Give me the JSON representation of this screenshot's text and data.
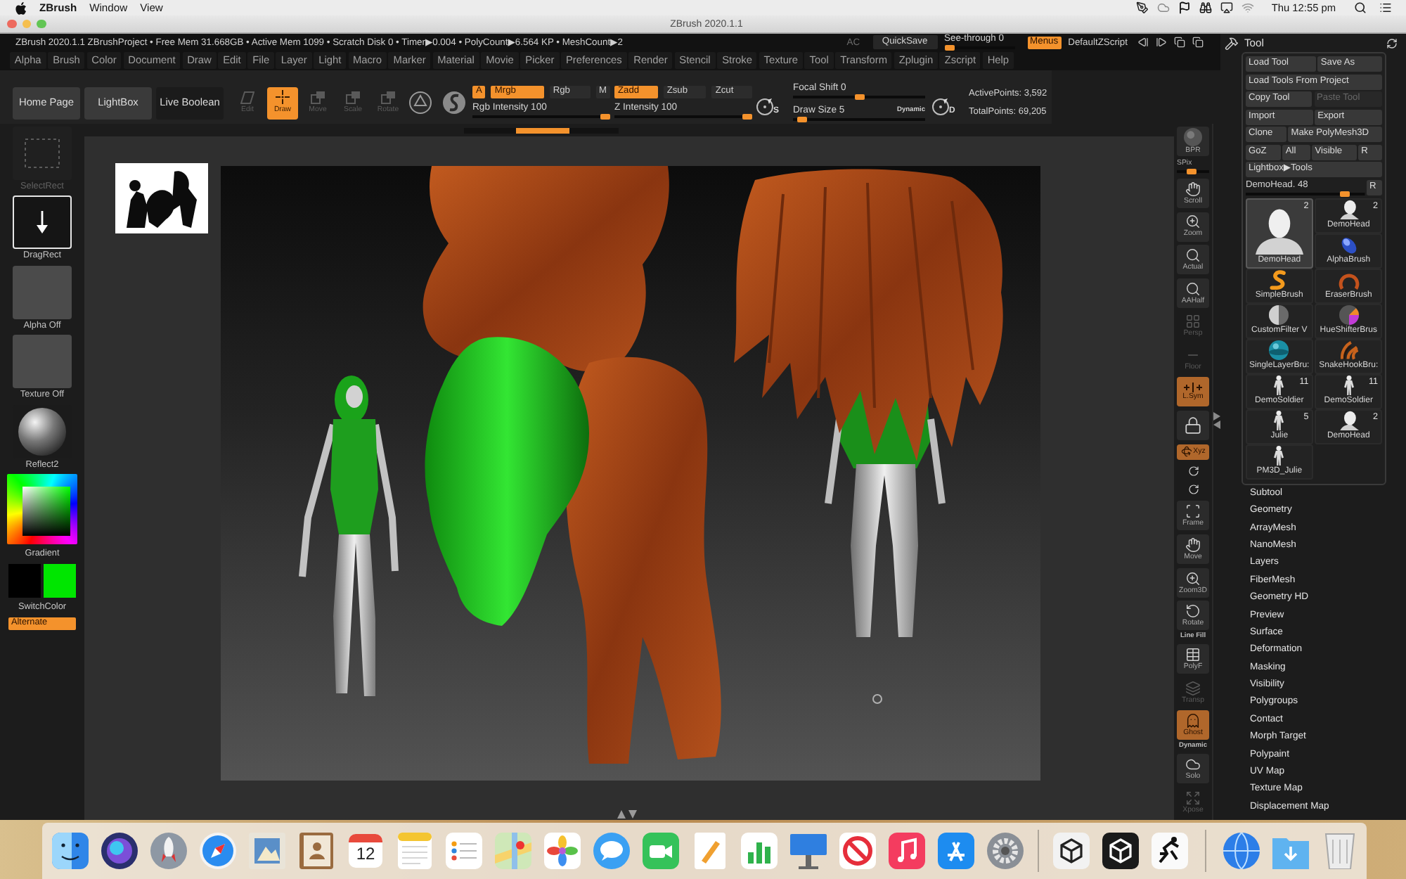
{
  "mac_menu_bar": {
    "app": "ZBrush",
    "menus": [
      "Window",
      "View"
    ],
    "clock": "Thu 12:55 pm"
  },
  "window": {
    "title": "ZBrush 2020.1.1"
  },
  "info_bar": {
    "status": "ZBrush 2020.1.1 ZBrushProject • Free Mem 31.668GB • Active Mem 1099 • Scratch Disk 0 • Timer▶0.004 • PolyCount▶6.564 KP • MeshCount▶2",
    "ac": "AC",
    "quick_save": "QuickSave",
    "see_through": {
      "label": "See-through 0",
      "level": 0
    },
    "menus": {
      "label": "Menus",
      "on": true
    },
    "script": "DefaultZScript"
  },
  "menu_bar": [
    "Alpha",
    "Brush",
    "Color",
    "Document",
    "Draw",
    "Edit",
    "File",
    "Layer",
    "Light",
    "Macro",
    "Marker",
    "Material",
    "Movie",
    "Picker",
    "Preferences",
    "Render",
    "Stencil",
    "Stroke",
    "Texture",
    "Tool",
    "Transform",
    "Zplugin",
    "Zscript",
    "Help"
  ],
  "top_shelf": {
    "buttons": [
      {
        "label": "Home Page"
      },
      {
        "label": "LightBox"
      }
    ],
    "live_boolean": {
      "label": "Live Boolean",
      "on": false
    },
    "modes": [
      {
        "label": "Edit",
        "kind": "edit",
        "selected": false,
        "disabled": true
      },
      {
        "label": "Draw",
        "kind": "draw",
        "selected": true,
        "disabled": false
      },
      {
        "label": "Move",
        "kind": "move",
        "selected": false,
        "disabled": true
      },
      {
        "label": "Scale",
        "kind": "scale",
        "selected": false,
        "disabled": true
      },
      {
        "label": "Rotate",
        "kind": "rotate",
        "selected": false,
        "disabled": true
      }
    ],
    "color_channels": [
      {
        "label": "A",
        "on": true
      },
      {
        "label": "Mrgb",
        "on": true
      },
      {
        "label": "Rgb",
        "on": false
      },
      {
        "label": "M",
        "on": false
      }
    ],
    "rgb_intensity": {
      "label": "Rgb Intensity 100",
      "level": 1
    },
    "depth_channels": [
      {
        "label": "Zadd",
        "on": true
      },
      {
        "label": "Zsub",
        "on": false
      },
      {
        "label": "Zcut",
        "on": false
      }
    ],
    "z_intensity": {
      "label": "Z Intensity 100",
      "level": 1
    },
    "stroke_button": "S",
    "focal_shift": {
      "label": "Focal Shift 0",
      "level": 0.5
    },
    "draw_size": {
      "label": "Draw Size 5",
      "level": 0.04,
      "dynamic": "Dynamic"
    },
    "document_button": "D",
    "active_points": "ActivePoints: 3,592",
    "total_points": "TotalPoints: 69,205"
  },
  "left_shelf": {
    "tools": [
      {
        "label": "SelectRect",
        "kind": "select_rect",
        "disabled": true
      },
      {
        "label": "DragRect",
        "kind": "drag_rect",
        "disabled": false
      },
      {
        "label": "Alpha Off",
        "kind": "empty",
        "disabled": false
      },
      {
        "label": "Texture Off",
        "kind": "empty",
        "disabled": false
      },
      {
        "label": "Reflect2",
        "kind": "material",
        "disabled": false
      }
    ],
    "color": {
      "gradient": "Gradient",
      "swatches": [
        {
          "color": "#000000"
        },
        {
          "color": "#00e600"
        }
      ],
      "switch": "SwitchColor",
      "alternate": {
        "label": "Alternate",
        "on": true
      }
    }
  },
  "right_shelf": {
    "render": {
      "label": "BPR",
      "on": false,
      "disabled": false
    },
    "spix": {
      "label": "SPix",
      "level": 0.45
    },
    "buttons": [
      {
        "kind": "scroll",
        "label": "Scroll",
        "on": false,
        "disabled": false
      },
      {
        "kind": "zoom",
        "label": "Zoom",
        "on": false,
        "disabled": false
      },
      {
        "kind": "actual",
        "label": "Actual",
        "on": false,
        "disabled": false
      },
      {
        "kind": "aahalf",
        "label": "AAHalf",
        "on": false,
        "disabled": false
      },
      {
        "kind": "persp",
        "label": "Persp",
        "on": false,
        "disabled": true
      },
      {
        "kind": "floor",
        "label": "Floor",
        "on": false,
        "disabled": true
      },
      {
        "kind": "lsym",
        "label": "L.Sym",
        "on": true,
        "disabled": false
      },
      {
        "kind": "local",
        "on": false,
        "disabled": false
      },
      {
        "kind": "xyz",
        "label": "Xyz",
        "on": true,
        "disabled": false
      },
      {
        "kind": "axis",
        "on": false,
        "disabled": false
      },
      {
        "kind": "axis",
        "on": false,
        "disabled": false
      },
      {
        "kind": "frame",
        "label": "Frame",
        "on": false,
        "disabled": false
      },
      {
        "kind": "move",
        "label": "Move",
        "on": false,
        "disabled": false
      },
      {
        "kind": "zoom3d",
        "label": "Zoom3D",
        "on": false,
        "disabled": false
      },
      {
        "kind": "rotate",
        "label": "Rotate",
        "on": false,
        "disabled": false
      },
      {
        "kind": "polyf",
        "caption": "Line Fill",
        "label": "PolyF",
        "on": false,
        "disabled": false
      },
      {
        "kind": "transp",
        "label": "Transp",
        "on": false,
        "disabled": true
      },
      {
        "kind": "ghost",
        "label": "Ghost",
        "on": true,
        "disabled": false
      },
      {
        "kind": "solo",
        "caption": "Dynamic",
        "label": "Solo",
        "on": false,
        "disabled": false
      },
      {
        "kind": "xpose",
        "label": "Xpose",
        "on": false,
        "disabled": true
      }
    ]
  },
  "tool_palette": {
    "title": "Tool",
    "button_rows": [
      [
        {
          "label": "Load Tool",
          "disabled": false
        },
        {
          "label": "Save As",
          "disabled": false
        }
      ],
      [
        {
          "label": "Load Tools From Project",
          "disabled": false
        }
      ],
      [
        {
          "label": "Copy Tool",
          "disabled": false
        },
        {
          "label": "Paste Tool",
          "disabled": true
        }
      ],
      [
        {
          "label": "Import",
          "disabled": false
        },
        {
          "label": "Export",
          "disabled": false
        }
      ],
      [
        {
          "label": "Clone",
          "disabled": false
        },
        {
          "label": "Make PolyMesh3D",
          "disabled": false
        }
      ],
      [
        {
          "label": "GoZ",
          "disabled": false
        },
        {
          "label": "All",
          "disabled": false
        },
        {
          "label": "Visible",
          "disabled": false
        },
        {
          "label": "R",
          "disabled": false
        }
      ],
      [
        {
          "label": "Lightbox▶Tools",
          "disabled": false
        }
      ]
    ],
    "subtool_slider": {
      "label": "DemoHead. 48",
      "level": 0.87,
      "reset": "R"
    },
    "tools": [
      {
        "label": "DemoHead",
        "count": "2",
        "kind": "head",
        "selected": true
      },
      {
        "label": "DemoHead",
        "count": "2",
        "kind": "head_side",
        "selected": false
      },
      {
        "label": "AlphaBrush",
        "kind": "alpha_brush",
        "selected": false
      },
      {
        "label": "SimpleBrush",
        "kind": "simple_brush",
        "selected": false
      },
      {
        "label": "EraserBrush",
        "kind": "eraser_brush",
        "selected": false
      },
      {
        "label": "CustomFilter V",
        "kind": "filter_sphere",
        "selected": false
      },
      {
        "label": "HueShifterBrus",
        "kind": "hue_sphere",
        "selected": false
      },
      {
        "label": "SingleLayerBru:",
        "kind": "layer_sphere",
        "selected": false
      },
      {
        "label": "SnakeHookBru:",
        "kind": "snake_hook",
        "selected": false
      },
      {
        "label": "DemoSoldier",
        "count": "11",
        "kind": "figure",
        "selected": false
      },
      {
        "label": "DemoSoldier",
        "count": "11",
        "kind": "figure",
        "selected": false
      },
      {
        "label": "Julie",
        "count": "5",
        "kind": "figure",
        "selected": false
      },
      {
        "label": "DemoHead",
        "count": "2",
        "kind": "head_side",
        "selected": false
      },
      {
        "label": "PM3D_Julie",
        "kind": "figure",
        "selected": false
      }
    ],
    "sub_palettes": [
      "Subtool",
      "Geometry",
      "ArrayMesh",
      "NanoMesh",
      "Layers",
      "FiberMesh",
      "Geometry HD",
      "Preview",
      "Surface",
      "Deformation",
      "Masking",
      "Visibility",
      "Polygroups",
      "Contact",
      "Morph Target",
      "Polypaint",
      "UV Map",
      "Texture Map",
      "Displacement Map"
    ]
  },
  "dock": {
    "calendar_day": "12"
  }
}
